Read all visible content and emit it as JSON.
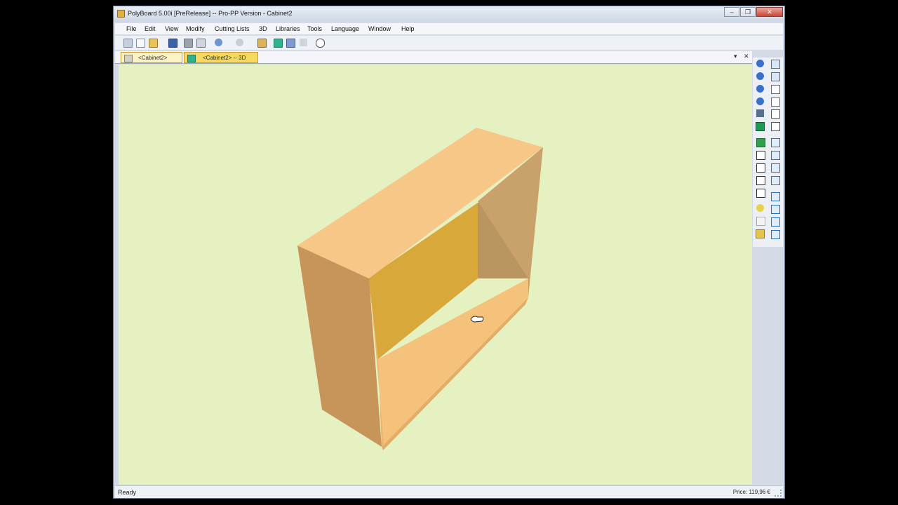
{
  "window": {
    "title": "PolyBoard 5.00i [PreRelease] -- Pro-PP Version - Cabinet2",
    "controls": [
      "–",
      "❐",
      "✕"
    ]
  },
  "menu": [
    "File",
    "Edit",
    "View",
    "Modify",
    "Cutting Lists",
    "3D",
    "Libraries",
    "Tools",
    "Language",
    "Window",
    "Help"
  ],
  "tabs": [
    {
      "label": "<Cabinet2>"
    },
    {
      "label": "<Cabinet2> -- 3D"
    }
  ],
  "tab_controls": {
    "dropdown": "▾",
    "close": "✕"
  },
  "status": {
    "left": "Ready",
    "right": "Price: 119,96 €"
  },
  "colors": {
    "viewport_bg": "#e6f1c2",
    "wood_light": "#f6c786",
    "wood_dark": "#c8964f",
    "wood_inner": "#d8a83a",
    "active_tab": "#f6d960"
  }
}
